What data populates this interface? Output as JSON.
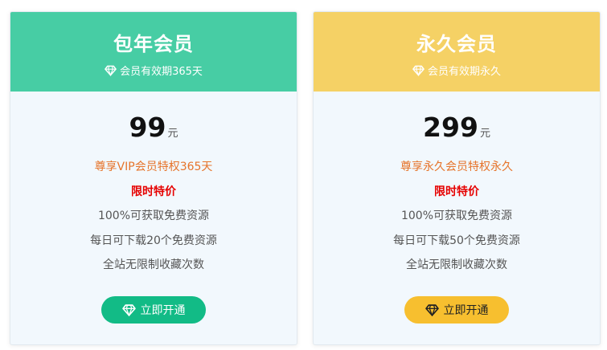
{
  "plans": [
    {
      "title": "包年会员",
      "subtitle": "会员有效期365天",
      "price": "99",
      "unit": "元",
      "features": [
        "尊享VIP会员特权365天",
        "限时特价",
        "100%可获取免费资源",
        "每日可下载20个免费资源",
        "全站无限制收藏次数"
      ],
      "button": "立即开通",
      "header_color": "#47cda4",
      "button_color": "#12bb86"
    },
    {
      "title": "永久会员",
      "subtitle": "会员有效期永久",
      "price": "299",
      "unit": "元",
      "features": [
        "尊享永久会员特权永久",
        "限时特价",
        "100%可获取免费资源",
        "每日可下载50个免费资源",
        "全站无限制收藏次数"
      ],
      "button": "立即开通",
      "header_color": "#f5d165",
      "button_color": "#f7bf2f"
    }
  ],
  "icons": {
    "subtitle": "diamond-icon",
    "button": "diamond-icon"
  }
}
